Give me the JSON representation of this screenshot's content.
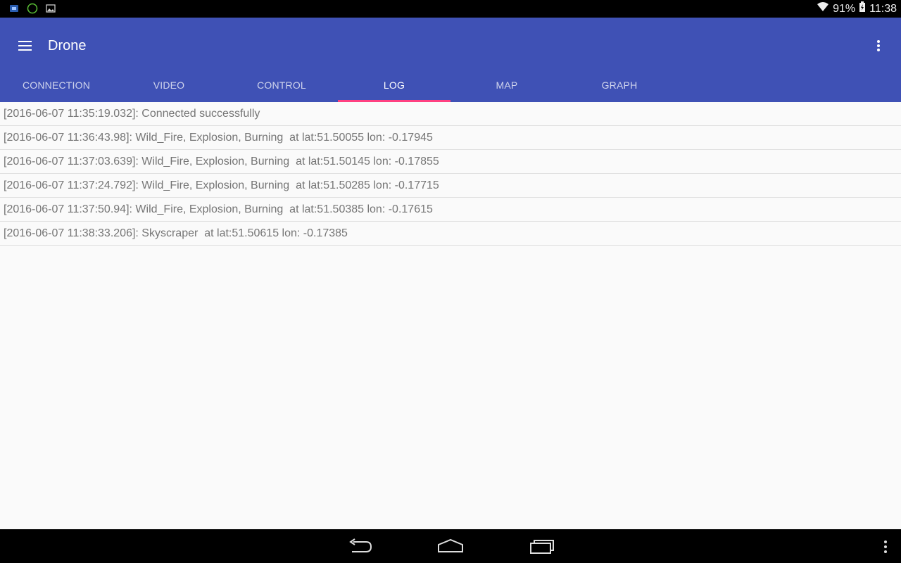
{
  "status_bar": {
    "left_icons": [
      "notification-app-icon",
      "battery-saver-icon",
      "image-icon"
    ],
    "notification_badge": "91",
    "battery": "91%",
    "time": "11:38"
  },
  "app_bar": {
    "title": "Drone",
    "color": "#3f51b5",
    "tabs": [
      {
        "label": "CONNECTION"
      },
      {
        "label": "VIDEO"
      },
      {
        "label": "CONTROL"
      },
      {
        "label": "LOG"
      },
      {
        "label": "MAP"
      },
      {
        "label": "GRAPH"
      }
    ],
    "active_tab": "LOG",
    "indicator_color": "#ff4081"
  },
  "log": {
    "entries": [
      "[2016-06-07 11:35:19.032]: Connected successfully",
      "[2016-06-07 11:36:43.98]: Wild_Fire, Explosion, Burning  at lat:51.50055 lon: -0.17945",
      "[2016-06-07 11:37:03.639]: Wild_Fire, Explosion, Burning  at lat:51.50145 lon: -0.17855",
      "[2016-06-07 11:37:24.792]: Wild_Fire, Explosion, Burning  at lat:51.50285 lon: -0.17715",
      "[2016-06-07 11:37:50.94]: Wild_Fire, Explosion, Burning  at lat:51.50385 lon: -0.17615",
      "[2016-06-07 11:38:33.206]: Skyscraper  at lat:51.50615 lon: -0.17385"
    ]
  },
  "nav_bar": {
    "buttons": [
      "back-icon",
      "home-icon",
      "recents-icon",
      "menu-icon"
    ]
  }
}
